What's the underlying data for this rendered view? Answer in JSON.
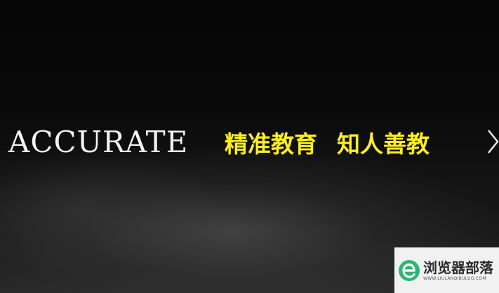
{
  "banner": {
    "brand_text": "ACCURATE",
    "slogan_left": "精准教育",
    "slogan_right": "知人善教",
    "slogan_color": "#ffee22",
    "next_icon": "chevron-right-icon"
  },
  "watermark": {
    "title": "浏览器部落",
    "subtitle": "WWW.LIULANQIBULUO.COM",
    "logo_icon": "e-logo",
    "accent_color": "#2bb673"
  }
}
